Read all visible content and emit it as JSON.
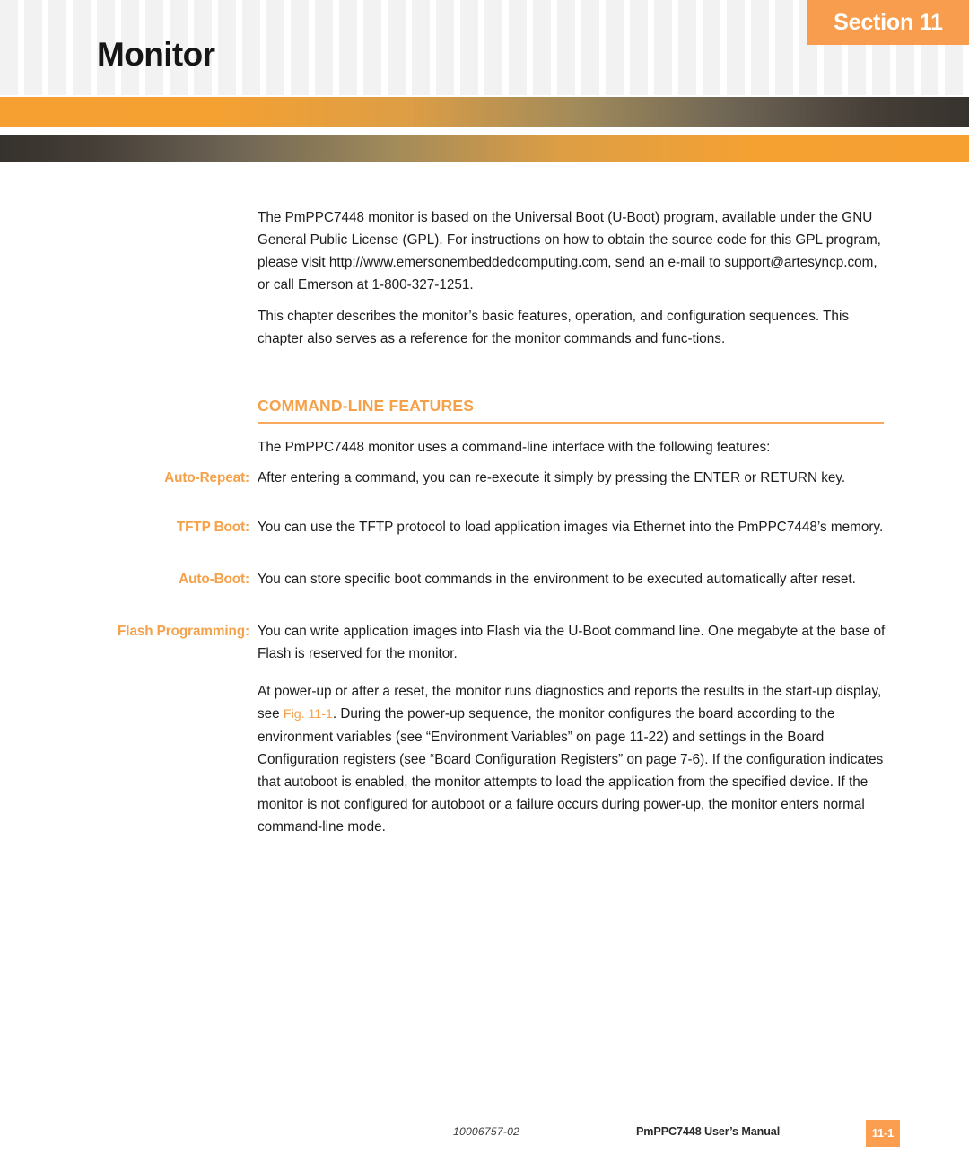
{
  "header": {
    "section_label": "Section 11",
    "title": "Monitor",
    "accent_color": "#f89d4d",
    "bar_dark_color": "#35312c"
  },
  "body": {
    "intro_paragraph": "The PmPPC7448 monitor is based on the Universal Boot (U-Boot) program, available under the GNU General Public License (GPL). For instructions on how to obtain the source code for this GPL program, please visit http://www.emersonembeddedcomputing.com, send an e-mail to support@artesyncp.com, or call Emerson at 1-800-327-1251.",
    "chapter_paragraph": "This chapter describes the monitor’s basic features, operation, and configuration sequences. This chapter also serves as a reference for the monitor commands and func-tions."
  },
  "section": {
    "heading": "COMMAND-LINE FEATURES",
    "lead_paragraph": "The PmPPC7448 monitor uses a command-line interface with the following features:",
    "features": [
      {
        "term": "Auto-Repeat:",
        "description": "After entering a command, you can re-execute it simply by pressing the ENTER or RETURN key."
      },
      {
        "term": "TFTP Boot:",
        "description": "You can use the TFTP protocol to load application images via Ethernet into the PmPPC7448’s memory."
      },
      {
        "term": "Auto-Boot:",
        "description": "You can store specific boot commands in the environment to be executed automatically after reset."
      },
      {
        "term": "Flash Programming:",
        "description": "You can write application images into Flash via the U-Boot command line. One megabyte at the base of Flash is reserved for the monitor."
      }
    ],
    "closing_paragraph_part1": "At power-up or after a reset, the monitor runs diagnostics and reports the results in the start-up display, see ",
    "closing_xref": "Fig. 11-1",
    "closing_paragraph_part2": ". During the power-up sequence, the monitor configures the board according to the environment variables (see “Environment Variables” on page 11-22) and settings in the Board Configuration registers (see “Board Configuration Registers” on page 7-6). If the configuration indicates that autoboot is enabled, the monitor attempts to load the application from the specified device. If the monitor is not configured for autoboot or a failure occurs during power-up, the monitor enters normal command-line mode."
  },
  "footer": {
    "document_number": "10006757-02",
    "manual_title": "PmPPC7448 User’s Manual",
    "page_number": "11-1"
  }
}
